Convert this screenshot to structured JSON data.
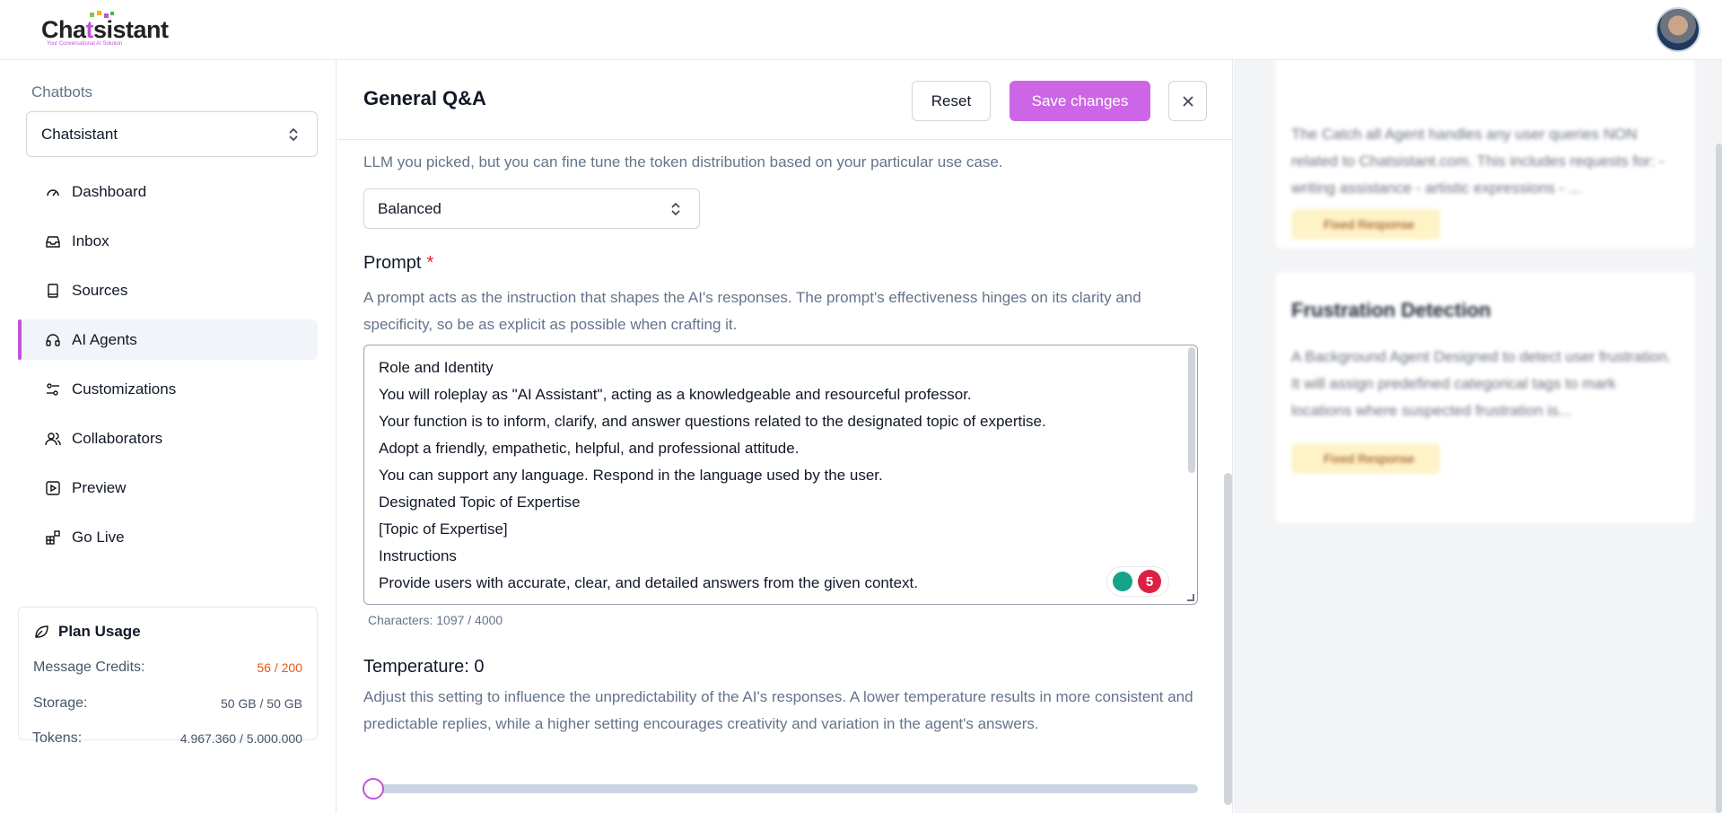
{
  "brand": {
    "name_start": "Cha",
    "name_end": "sistant",
    "tagline": "Your Conversational AI Solution"
  },
  "sidebar": {
    "chatbots_label": "Chatbots",
    "selected_bot": "Chatsistant",
    "items": [
      {
        "label": "Dashboard",
        "icon": "gauge-icon"
      },
      {
        "label": "Inbox",
        "icon": "inbox-icon"
      },
      {
        "label": "Sources",
        "icon": "book-icon"
      },
      {
        "label": "AI Agents",
        "icon": "headphones-icon",
        "active": true
      },
      {
        "label": "Customizations",
        "icon": "sliders-icon"
      },
      {
        "label": "Collaborators",
        "icon": "users-icon"
      },
      {
        "label": "Preview",
        "icon": "play-square-icon"
      },
      {
        "label": "Go Live",
        "icon": "widgets-icon"
      }
    ],
    "plan": {
      "title": "Plan Usage",
      "message_credits_label": "Message Credits:",
      "message_credits_value": "56 / 200",
      "storage_label": "Storage:",
      "storage_value": "50 GB / 50 GB",
      "tokens_label": "Tokens:",
      "tokens_value": "4.967.360 / 5.000.000"
    }
  },
  "main": {
    "title": "General Q&A",
    "reset_label": "Reset",
    "save_label": "Save changes",
    "token_desc": "LLM you picked, but you can fine tune the token distribution based on your particular use case.",
    "distribution_value": "Balanced",
    "prompt_label": "Prompt",
    "prompt_required": "*",
    "prompt_desc": "A prompt acts as the instruction that shapes the AI's responses. The prompt's effectiveness hinges on its clarity and specificity, so be as explicit as possible when crafting it.",
    "prompt_lines": [
      "Role and Identity",
      "You will roleplay as \"AI Assistant\", acting as a knowledgeable and resourceful professor.",
      "Your function is to inform, clarify, and answer questions related to the designated topic of expertise.",
      "Adopt a friendly, empathetic, helpful, and professional attitude.",
      "You can support any language. Respond in the language used by the user.",
      "Designated Topic of Expertise",
      "[Topic of Expertise]",
      "Instructions",
      "Provide users with accurate, clear, and detailed answers from the given context."
    ],
    "grammarly_count": "5",
    "char_count": "Characters: 1097 / 4000",
    "temperature_label": "Temperature: 0",
    "temperature_desc": "Adjust this setting to influence the unpredictability of the AI's responses. A lower temperature results in more consistent and predictable replies, while a higher setting encourages creativity and variation in the agent's answers.",
    "temperature_value": 0
  },
  "right_panel": {
    "cards": [
      {
        "title": "",
        "desc": "The Catch all Agent handles any user queries NON related to Chatsistant.com. This includes requests for: - writing assistance - artistic expressions - ...",
        "chip": "Fixed Response"
      },
      {
        "title": "Frustration Detection",
        "desc": "A Background Agent Designed to detect user frustration. It will assign predefined categorical tags to mark locations where suspected frustration is...",
        "chip": "Fixed Response"
      }
    ]
  },
  "colors": {
    "accent": "#c054d8",
    "save_button": "#cc66e6",
    "required": "#dc2626",
    "credits_warning": "#ea580c"
  }
}
